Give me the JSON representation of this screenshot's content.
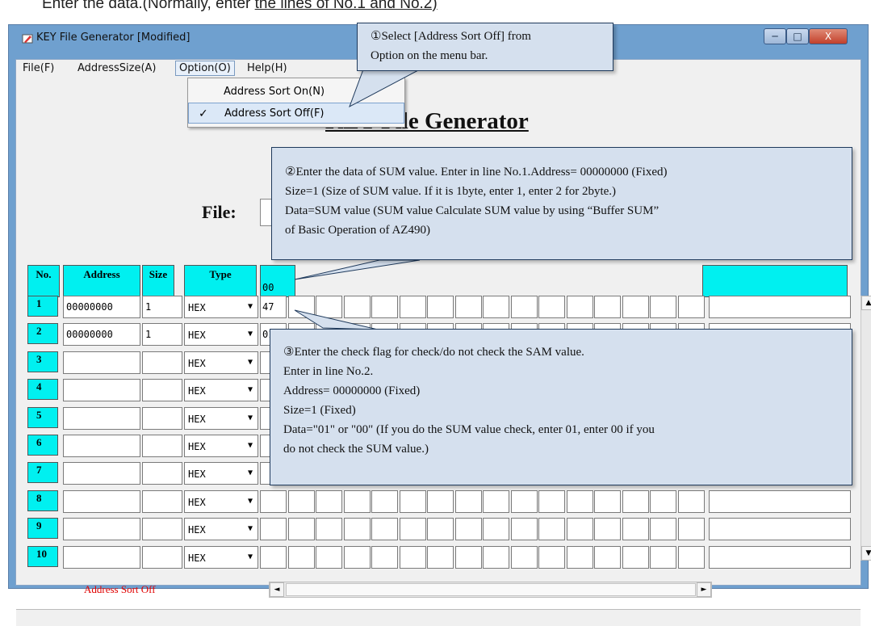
{
  "instruction": {
    "prefix": "Enter the data.(Normally, enter ",
    "underlined": "the lines of No.1 and No.2)"
  },
  "window": {
    "title": "KEY File Generator [Modified]",
    "min_glyph": "─",
    "max_glyph": "□",
    "close_glyph": "X"
  },
  "menu": {
    "file": "File(F)",
    "address_size": "AddressSize(A)",
    "option": "Option(O)",
    "help": "Help(H)"
  },
  "option_menu": {
    "items": [
      {
        "label": "Address Sort On(N)",
        "checked": false
      },
      {
        "label": "Address Sort Off(F)",
        "checked": true
      }
    ],
    "check_glyph": "✓"
  },
  "app": {
    "heading": "KEY File Generator",
    "file_label": "File:",
    "file_value": ""
  },
  "table": {
    "headers": {
      "no": "No.",
      "address": "Address",
      "size": "Size",
      "type": "Type",
      "data_offset": "00"
    },
    "rows": [
      {
        "no": "1",
        "address": "00000000",
        "size": "1",
        "type": "HEX",
        "data": "47"
      },
      {
        "no": "2",
        "address": "00000000",
        "size": "1",
        "type": "HEX",
        "data": "01"
      },
      {
        "no": "3",
        "address": "",
        "size": "",
        "type": "HEX",
        "data": ""
      },
      {
        "no": "4",
        "address": "",
        "size": "",
        "type": "HEX",
        "data": ""
      },
      {
        "no": "5",
        "address": "",
        "size": "",
        "type": "HEX",
        "data": ""
      },
      {
        "no": "6",
        "address": "",
        "size": "",
        "type": "HEX",
        "data": ""
      },
      {
        "no": "7",
        "address": "",
        "size": "",
        "type": "HEX",
        "data": ""
      },
      {
        "no": "8",
        "address": "",
        "size": "",
        "type": "HEX",
        "data": ""
      },
      {
        "no": "9",
        "address": "",
        "size": "",
        "type": "HEX",
        "data": ""
      },
      {
        "no": "10",
        "address": "",
        "size": "",
        "type": "HEX",
        "data": ""
      }
    ],
    "dropdown_glyph": "▼"
  },
  "status": {
    "sort_mode": "Address Sort Off"
  },
  "scroll": {
    "up": "▲",
    "down": "▼",
    "left": "◄",
    "right": "►"
  },
  "callouts": {
    "c1": [
      "①Select [Address Sort Off] from",
      "Option on the menu bar."
    ],
    "c2": [
      "②Enter the data of SUM value. Enter in line No.1.Address= 00000000 (Fixed)",
      "Size=1 (Size of SUM value. If it is 1byte, enter 1, enter 2 for 2byte.)",
      "Data=SUM value (SUM value Calculate SUM value by using “Buffer SUM”",
      "of Basic Operation of AZ490)"
    ],
    "c3": [
      "③Enter the check flag for check/do not check the SAM value.",
      "Enter in line No.2.",
      "Address= 00000000 (Fixed)",
      "Size=1 (Fixed)",
      "Data=\"01\" or \"00\" (If you do the SUM value check, enter 01, enter 00 if you",
      "do not check the SUM value.)"
    ]
  },
  "colors": {
    "header_cyan": "#00f0f0",
    "callout_fill": "#d5e0ee",
    "status_red": "#e00000",
    "titlebar_blue": "#6fa0cf"
  }
}
